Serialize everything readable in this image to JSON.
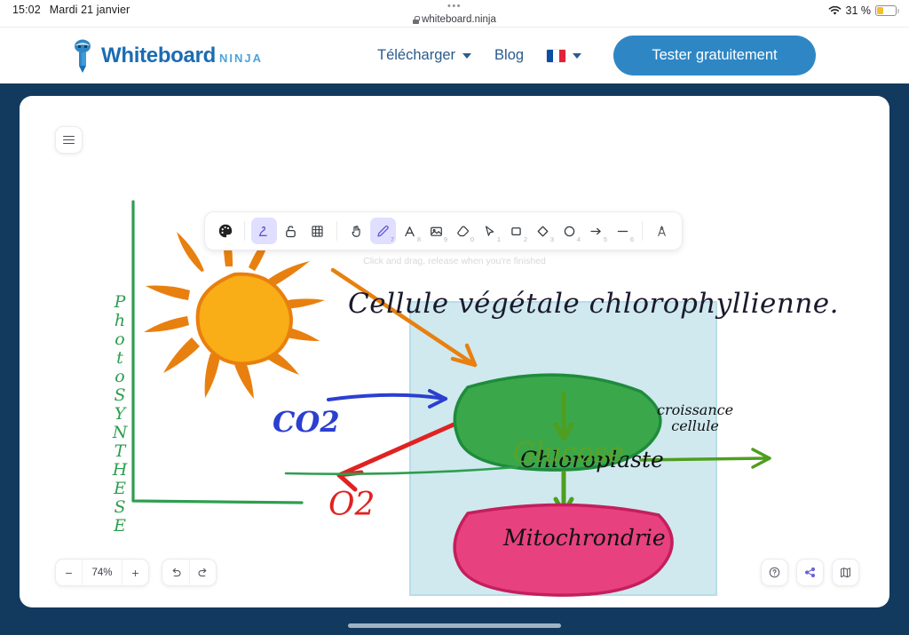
{
  "statusbar": {
    "time": "15:02",
    "date": "Mardi 21 janvier",
    "dots": "•••",
    "url": "whiteboard.ninja",
    "battery_percent": "31 %",
    "wifi_icon": "wifi-icon",
    "lock_icon": "lock-icon",
    "battery_icon": "battery-icon"
  },
  "header": {
    "logo_icon": "whiteboard-ninja-logo-icon",
    "brand_main": "Whiteboard",
    "brand_sub": "NINJA",
    "nav": [
      {
        "label": "Télécharger",
        "has_caret": true,
        "icon": "chevron-down-icon"
      },
      {
        "label": "Blog",
        "has_caret": false,
        "icon": ""
      }
    ],
    "language": {
      "flag": "french-flag-icon",
      "has_caret": true
    },
    "cta_label": "Tester gratuitement",
    "cta_color": "#2e87c4"
  },
  "app": {
    "menu_button_icon": "hamburger-menu-icon",
    "hint": "Click and drag, release when you're finished",
    "frame_color": "#123a5e",
    "toolbar": [
      {
        "name": "color-palette-icon",
        "shortcut": "",
        "active": false
      },
      {
        "name": "shape-selection-icon",
        "shortcut": "",
        "active": true
      },
      {
        "name": "lock-open-icon",
        "shortcut": "",
        "active": false
      },
      {
        "name": "grid-icon",
        "shortcut": "",
        "active": false
      },
      {
        "name": "hand-icon",
        "shortcut": "",
        "active": false
      },
      {
        "name": "pencil-icon",
        "shortcut": "7",
        "active": true
      },
      {
        "name": "text-icon",
        "shortcut": "8",
        "active": false
      },
      {
        "name": "image-icon",
        "shortcut": "9",
        "active": false
      },
      {
        "name": "eraser-icon",
        "shortcut": "0",
        "active": false
      },
      {
        "name": "cursor-arrow-icon",
        "shortcut": "1",
        "active": false
      },
      {
        "name": "rectangle-icon",
        "shortcut": "2",
        "active": false
      },
      {
        "name": "diamond-icon",
        "shortcut": "3",
        "active": false
      },
      {
        "name": "ellipse-icon",
        "shortcut": "4",
        "active": false
      },
      {
        "name": "arrow-icon",
        "shortcut": "5",
        "active": false
      },
      {
        "name": "line-icon",
        "shortcut": "6",
        "active": false
      },
      {
        "name": "frame-tool-icon",
        "shortcut": "",
        "active": false
      }
    ],
    "zoom": {
      "minus": "−",
      "value": "74%",
      "plus": "+"
    },
    "history": {
      "undo_icon": "undo-icon",
      "redo_icon": "redo-icon"
    },
    "right_buttons": [
      {
        "name": "help-icon",
        "label": "?"
      },
      {
        "name": "share-icon",
        "label": ""
      },
      {
        "name": "library-icon",
        "label": ""
      }
    ]
  },
  "drawing": {
    "title": "Cellule végétale chlorophyllienne.",
    "vertical_label": "PhotoSYNTHESE",
    "vertical_letters": [
      "P",
      "h",
      "o",
      "t",
      "o",
      "S",
      "Y",
      "N",
      "T",
      "H",
      "E",
      "S",
      "E"
    ],
    "sun": {
      "name": "sun-drawing",
      "body_color": "#f9ad17",
      "ray_color": "#e8800f"
    },
    "cell_box": {
      "fill": "#cfe9ef",
      "stroke": "#b5dbe6"
    },
    "nodes": [
      {
        "label": "Chloroplaste",
        "fill": "#3aa84a",
        "stroke": "#1f8c3c",
        "text_color": "#111111"
      },
      {
        "label": "Mitochrondrie",
        "fill": "#e8417f",
        "stroke": "#c41f5c",
        "text_color": "#111111"
      }
    ],
    "labels": [
      {
        "text": "CO2",
        "color": "#2b3fd1"
      },
      {
        "text": "O2",
        "color": "#e02222"
      },
      {
        "text": "Glucose",
        "color": "#5aa328"
      },
      {
        "text": "croissance",
        "color": "#111111"
      },
      {
        "text": "cellule",
        "color": "#111111"
      }
    ],
    "arrow_colors": {
      "sunlight": "#e8800f",
      "co2": "#2b3fd1",
      "o2": "#e02222",
      "green": "#4f9e1f",
      "axis": "#2e9e4f"
    }
  }
}
